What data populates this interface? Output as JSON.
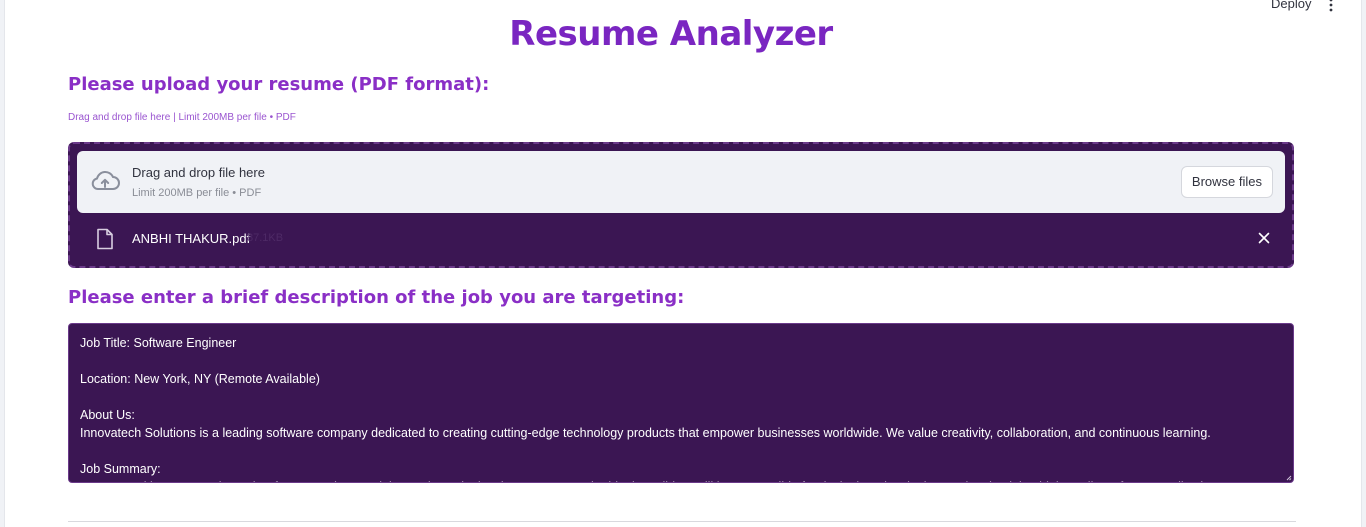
{
  "header": {
    "deploy_label": "Deploy",
    "menu_icon": "vertical-ellipsis-icon"
  },
  "app": {
    "title": "Resume Analyzer"
  },
  "upload": {
    "heading": "Please upload your resume (PDF format):",
    "hint": "Drag and drop file here | Limit 200MB per file • PDF",
    "dropzone_title": "Drag and drop file here",
    "dropzone_subtitle": "Limit 200MB per file • PDF",
    "browse_label": "Browse files",
    "icon": "cloud-upload-icon",
    "file": {
      "name": "ANBHI THAKUR.pdf",
      "size": "87.1KB",
      "icon": "file-icon",
      "remove_icon": "close-icon"
    }
  },
  "job": {
    "heading": "Please enter a brief description of the job you are targeting:",
    "description": "Job Title: Software Engineer\n\nLocation: New York, NY (Remote Available)\n\nAbout Us:\nInnovatech Solutions is a leading software company dedicated to creating cutting-edge technology products that empower businesses worldwide. We value creativity, collaboration, and continuous learning.\n\nJob Summary:\nWe are seeking an experienced Software Engineer to join our dynamic development team. The ideal candidate will be responsible for designing, developing, and maintaining high-quality software applications, collaborating with cross-functional teams."
  },
  "colors": {
    "title": "#7a26c1",
    "heading": "#8a2fc6",
    "panel_bg": "#3b1653",
    "dropzone_bg": "#f0f2f6"
  }
}
